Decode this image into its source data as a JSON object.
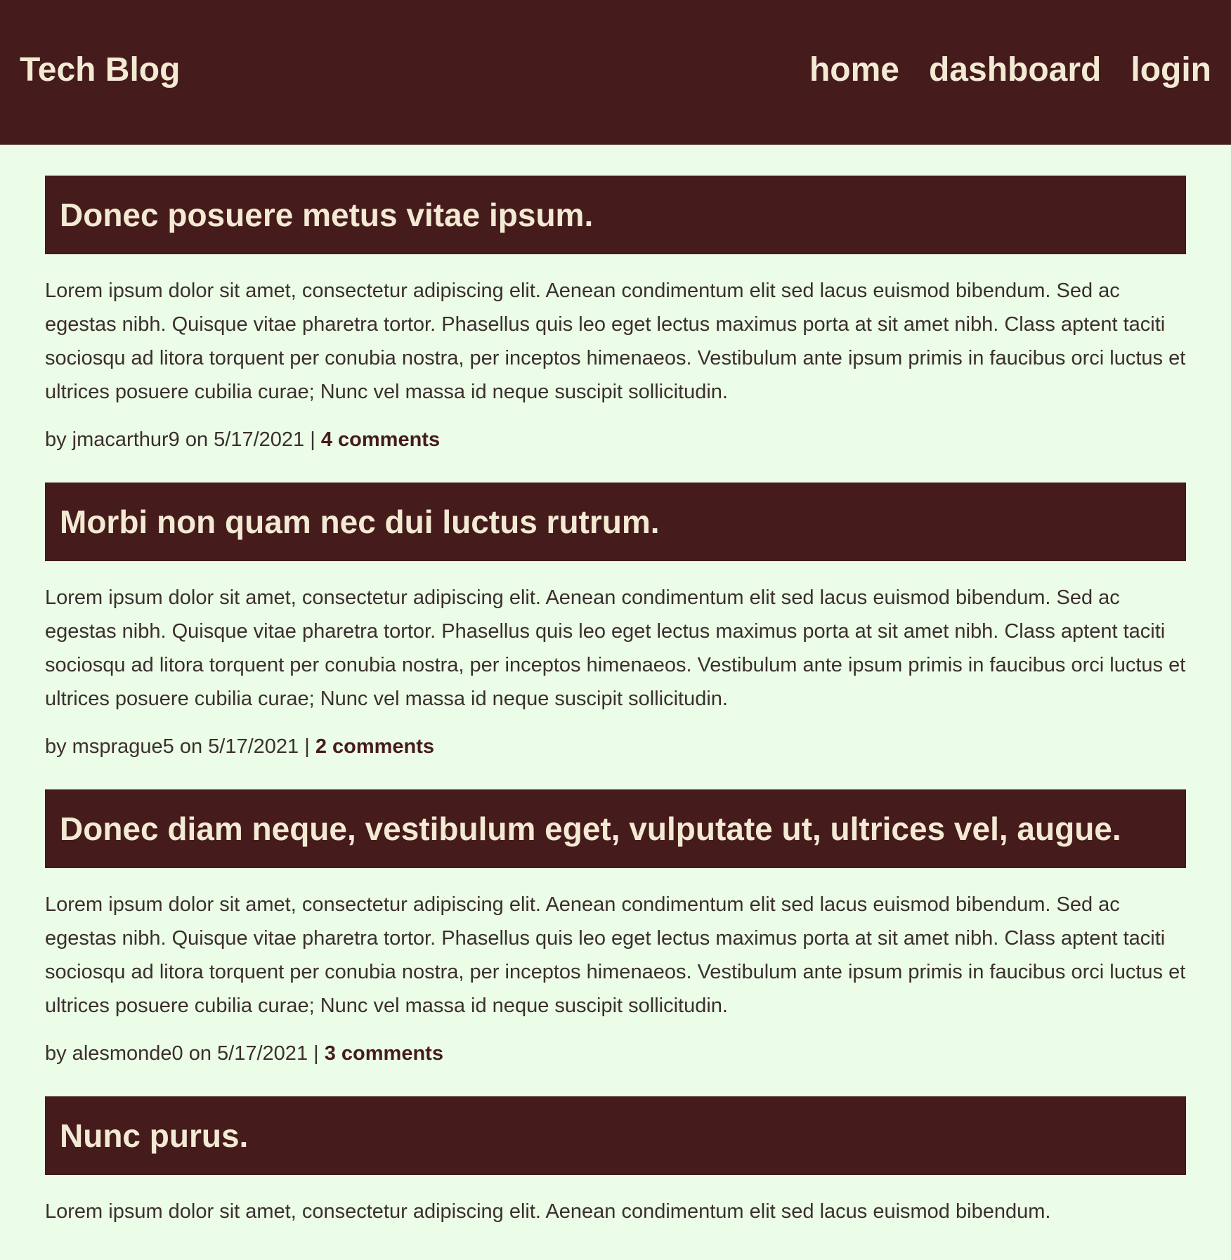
{
  "header": {
    "site_title": "Tech Blog",
    "nav": [
      {
        "label": "home"
      },
      {
        "label": "dashboard"
      },
      {
        "label": "login"
      }
    ]
  },
  "posts": [
    {
      "title": "Donec posuere metus vitae ipsum.",
      "body": "Lorem ipsum dolor sit amet, consectetur adipiscing elit. Aenean condimentum elit sed lacus euismod bibendum. Sed ac egestas nibh. Quisque vitae pharetra tortor. Phasellus quis leo eget lectus maximus porta at sit amet nibh. Class aptent taciti sociosqu ad litora torquent per conubia nostra, per inceptos himenaeos. Vestibulum ante ipsum primis in faucibus orci luctus et ultrices posuere cubilia curae; Nunc vel massa id neque suscipit sollicitudin.",
      "meta": "by jmacarthur9 on 5/17/2021 | ",
      "comments": "4 comments"
    },
    {
      "title": "Morbi non quam nec dui luctus rutrum.",
      "body": "Lorem ipsum dolor sit amet, consectetur adipiscing elit. Aenean condimentum elit sed lacus euismod bibendum. Sed ac egestas nibh. Quisque vitae pharetra tortor. Phasellus quis leo eget lectus maximus porta at sit amet nibh. Class aptent taciti sociosqu ad litora torquent per conubia nostra, per inceptos himenaeos. Vestibulum ante ipsum primis in faucibus orci luctus et ultrices posuere cubilia curae; Nunc vel massa id neque suscipit sollicitudin.",
      "meta": "by msprague5 on 5/17/2021 | ",
      "comments": "2 comments"
    },
    {
      "title": "Donec diam neque, vestibulum eget, vulputate ut, ultrices vel, augue.",
      "body": "Lorem ipsum dolor sit amet, consectetur adipiscing elit. Aenean condimentum elit sed lacus euismod bibendum. Sed ac egestas nibh. Quisque vitae pharetra tortor. Phasellus quis leo eget lectus maximus porta at sit amet nibh. Class aptent taciti sociosqu ad litora torquent per conubia nostra, per inceptos himenaeos. Vestibulum ante ipsum primis in faucibus orci luctus et ultrices posuere cubilia curae; Nunc vel massa id neque suscipit sollicitudin.",
      "meta": "by alesmonde0 on 5/17/2021 | ",
      "comments": "3 comments"
    },
    {
      "title": "Nunc purus.",
      "body": "Lorem ipsum dolor sit amet, consectetur adipiscing elit. Aenean condimentum elit sed lacus euismod bibendum.",
      "meta": "",
      "comments": ""
    }
  ],
  "colors": {
    "header_bg": "#461b1b",
    "page_bg": "#ebfde6",
    "header_text": "#f3ead4"
  }
}
